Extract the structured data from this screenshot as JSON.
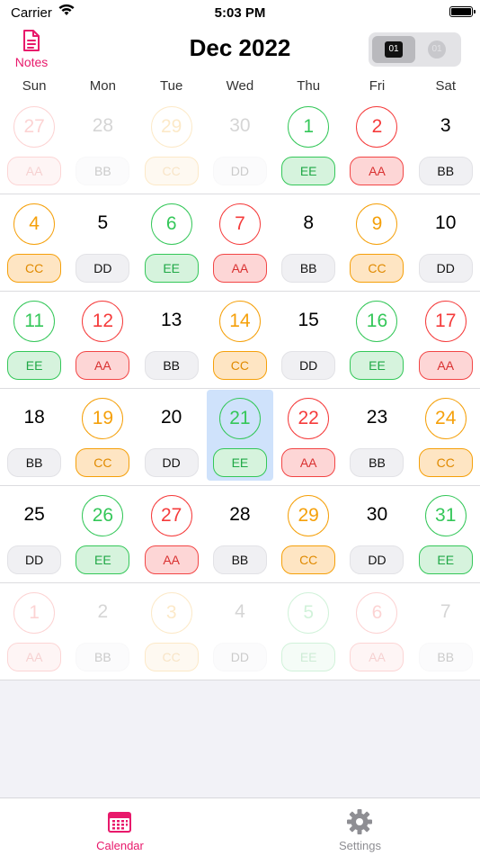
{
  "status": {
    "carrier": "Carrier",
    "time": "5:03 PM"
  },
  "header": {
    "notes_label": "Notes",
    "title": "Dec 2022",
    "seg_option_1": "01",
    "seg_option_2": "01"
  },
  "weekdays": [
    "Sun",
    "Mon",
    "Tue",
    "Wed",
    "Thu",
    "Fri",
    "Sat"
  ],
  "weeks": [
    [
      {
        "day": "27",
        "code": "AA",
        "color": "red",
        "dim": true
      },
      {
        "day": "28",
        "code": "BB",
        "color": "plain",
        "dim": true
      },
      {
        "day": "29",
        "code": "CC",
        "color": "orange",
        "dim": true
      },
      {
        "day": "30",
        "code": "DD",
        "color": "plain",
        "dim": true
      },
      {
        "day": "1",
        "code": "EE",
        "color": "green",
        "dim": false
      },
      {
        "day": "2",
        "code": "AA",
        "color": "red",
        "dim": false
      },
      {
        "day": "3",
        "code": "BB",
        "color": "plain",
        "dim": false
      }
    ],
    [
      {
        "day": "4",
        "code": "CC",
        "color": "orange",
        "dim": false
      },
      {
        "day": "5",
        "code": "DD",
        "color": "plain",
        "dim": false
      },
      {
        "day": "6",
        "code": "EE",
        "color": "green",
        "dim": false
      },
      {
        "day": "7",
        "code": "AA",
        "color": "red",
        "dim": false
      },
      {
        "day": "8",
        "code": "BB",
        "color": "plain",
        "dim": false
      },
      {
        "day": "9",
        "code": "CC",
        "color": "orange",
        "dim": false
      },
      {
        "day": "10",
        "code": "DD",
        "color": "plain",
        "dim": false
      }
    ],
    [
      {
        "day": "11",
        "code": "EE",
        "color": "green",
        "dim": false
      },
      {
        "day": "12",
        "code": "AA",
        "color": "red",
        "dim": false
      },
      {
        "day": "13",
        "code": "BB",
        "color": "plain",
        "dim": false
      },
      {
        "day": "14",
        "code": "CC",
        "color": "orange",
        "dim": false
      },
      {
        "day": "15",
        "code": "DD",
        "color": "plain",
        "dim": false
      },
      {
        "day": "16",
        "code": "EE",
        "color": "green",
        "dim": false
      },
      {
        "day": "17",
        "code": "AA",
        "color": "red",
        "dim": false
      }
    ],
    [
      {
        "day": "18",
        "code": "BB",
        "color": "plain",
        "dim": false
      },
      {
        "day": "19",
        "code": "CC",
        "color": "orange",
        "dim": false
      },
      {
        "day": "20",
        "code": "DD",
        "color": "plain",
        "dim": false
      },
      {
        "day": "21",
        "code": "EE",
        "color": "green",
        "dim": false,
        "selected": true
      },
      {
        "day": "22",
        "code": "AA",
        "color": "red",
        "dim": false
      },
      {
        "day": "23",
        "code": "BB",
        "color": "plain",
        "dim": false
      },
      {
        "day": "24",
        "code": "CC",
        "color": "orange",
        "dim": false
      }
    ],
    [
      {
        "day": "25",
        "code": "DD",
        "color": "plain",
        "dim": false
      },
      {
        "day": "26",
        "code": "EE",
        "color": "green",
        "dim": false
      },
      {
        "day": "27",
        "code": "AA",
        "color": "red",
        "dim": false
      },
      {
        "day": "28",
        "code": "BB",
        "color": "plain",
        "dim": false
      },
      {
        "day": "29",
        "code": "CC",
        "color": "orange",
        "dim": false
      },
      {
        "day": "30",
        "code": "DD",
        "color": "plain",
        "dim": false
      },
      {
        "day": "31",
        "code": "EE",
        "color": "green",
        "dim": false
      }
    ],
    [
      {
        "day": "1",
        "code": "AA",
        "color": "red",
        "dim": true
      },
      {
        "day": "2",
        "code": "BB",
        "color": "plain",
        "dim": true
      },
      {
        "day": "3",
        "code": "CC",
        "color": "orange",
        "dim": true
      },
      {
        "day": "4",
        "code": "DD",
        "color": "plain",
        "dim": true
      },
      {
        "day": "5",
        "code": "EE",
        "color": "green",
        "dim": true
      },
      {
        "day": "6",
        "code": "AA",
        "color": "red",
        "dim": true
      },
      {
        "day": "7",
        "code": "BB",
        "color": "plain",
        "dim": true
      }
    ]
  ],
  "tabs": [
    {
      "label": "Calendar",
      "icon": "calendar-icon",
      "active": true
    },
    {
      "label": "Settings",
      "icon": "gear-icon",
      "active": false
    }
  ],
  "colors": {
    "accent": "#e8196b",
    "green": "#34c759",
    "red": "#f53b3b",
    "orange": "#f5a00a",
    "selected": "#cfe2fb"
  }
}
